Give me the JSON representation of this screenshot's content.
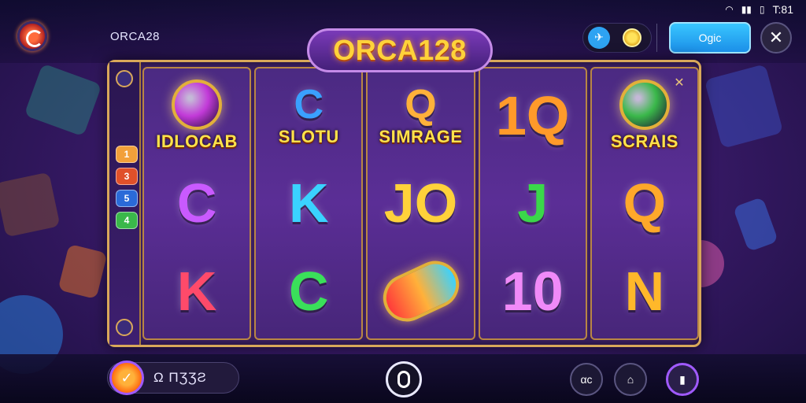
{
  "header": {
    "app_name": "ORCA28",
    "game_title": "ORCA128",
    "login_label": "Ogic",
    "status": {
      "time": "T:81"
    }
  },
  "paylines": [
    {
      "label": "1",
      "color": "#f2a03a"
    },
    {
      "label": "3",
      "color": "#e0502a"
    },
    {
      "label": "5",
      "color": "#2a6ad8"
    },
    {
      "label": "4",
      "color": "#3ab84a"
    }
  ],
  "reels": [
    [
      {
        "kind": "special",
        "label": "IDLOCAB",
        "orb_color": "#c23ad8"
      },
      {
        "kind": "letter",
        "text": "C",
        "color": "#c95aff"
      },
      {
        "kind": "letter",
        "text": "K",
        "color": "#ff4a6a"
      }
    ],
    [
      {
        "kind": "special",
        "label": "SLOTU",
        "letter": "C",
        "letter_color": "#3aa0ff"
      },
      {
        "kind": "letter",
        "text": "K",
        "color": "#3ad2ff"
      },
      {
        "kind": "letter",
        "text": "C",
        "color": "#3ae05a"
      }
    ],
    [
      {
        "kind": "special",
        "label": "SIMRAGE",
        "letter": "Q",
        "letter_color": "#ffb13a"
      },
      {
        "kind": "letter",
        "text": "JO",
        "color": "#ffd23a"
      },
      {
        "kind": "scroll",
        "label": "wild-scroll"
      }
    ],
    [
      {
        "kind": "letter",
        "text": "1Q",
        "color": "#ff9a2a"
      },
      {
        "kind": "letter",
        "text": "J",
        "color": "#3ad84a"
      },
      {
        "kind": "letter",
        "text": "10",
        "color": "#f08af8"
      }
    ],
    [
      {
        "kind": "special",
        "label": "SCRAIS",
        "orb_color": "#3ab84a"
      },
      {
        "kind": "letter",
        "text": "Q",
        "color": "#ffa82a"
      },
      {
        "kind": "letter",
        "text": "N",
        "color": "#ffb82a"
      }
    ]
  ],
  "footer": {
    "balance_icon": "coin-icon",
    "balance_text": "Ω ΠƷƷƧ",
    "sound_label": "αc",
    "settings_icon": "settings-icon",
    "chat_icon": "chat-icon"
  }
}
